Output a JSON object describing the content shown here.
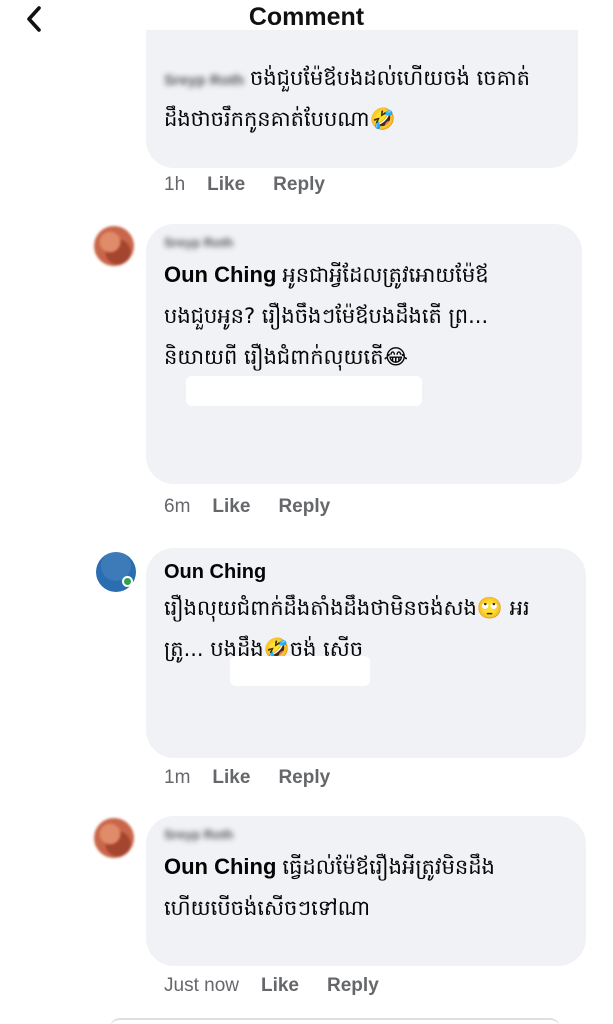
{
  "header": {
    "title": "Comment"
  },
  "comments": [
    {
      "author": "Sreyp Roth",
      "text": "ចង់ជួបម៉ែឪបងដល់ហើយចង់ ចេគាត់ដឹងថាចរឹកកូនគាត់បែបណា🤣",
      "time": "1h",
      "like": "Like",
      "reply": "Reply"
    },
    {
      "author": "Sreyp Roth",
      "mention": "Oun Ching",
      "text": "អូនជាអ្វីដែលត្រូវអោយម៉ែឪ បងជួបអូន? រឿងចឹងៗម៉ែឪបងដឹងតើ ព្រ... និយាយពី រឿងជំពាក់លុយតើ😂",
      "time": "6m",
      "like": "Like",
      "reply": "Reply"
    },
    {
      "author": "Oun Ching",
      "text": "រឿងលុយជំពាក់ដឹងតាំងដឹងថាមិនចង់សង🙄 អរ ត្រូ... បងដឹង🤣ចង់ សើច",
      "time": "1m",
      "like": "Like",
      "reply": "Reply"
    },
    {
      "author": "Sreyp Roth",
      "mention": "Oun Ching",
      "text": "ធ្វើដល់ម៉ែឪរឿងអីត្រូវមិនដឹង ហើយបើចង់សើចៗទៅណា",
      "time": "Just now",
      "like": "Like",
      "reply": "Reply"
    }
  ],
  "colors": {
    "bubble": "#f0f2f5",
    "meta": "#65676b",
    "online": "#31a24c"
  },
  "icons": {
    "back": "chevron-left-icon"
  }
}
